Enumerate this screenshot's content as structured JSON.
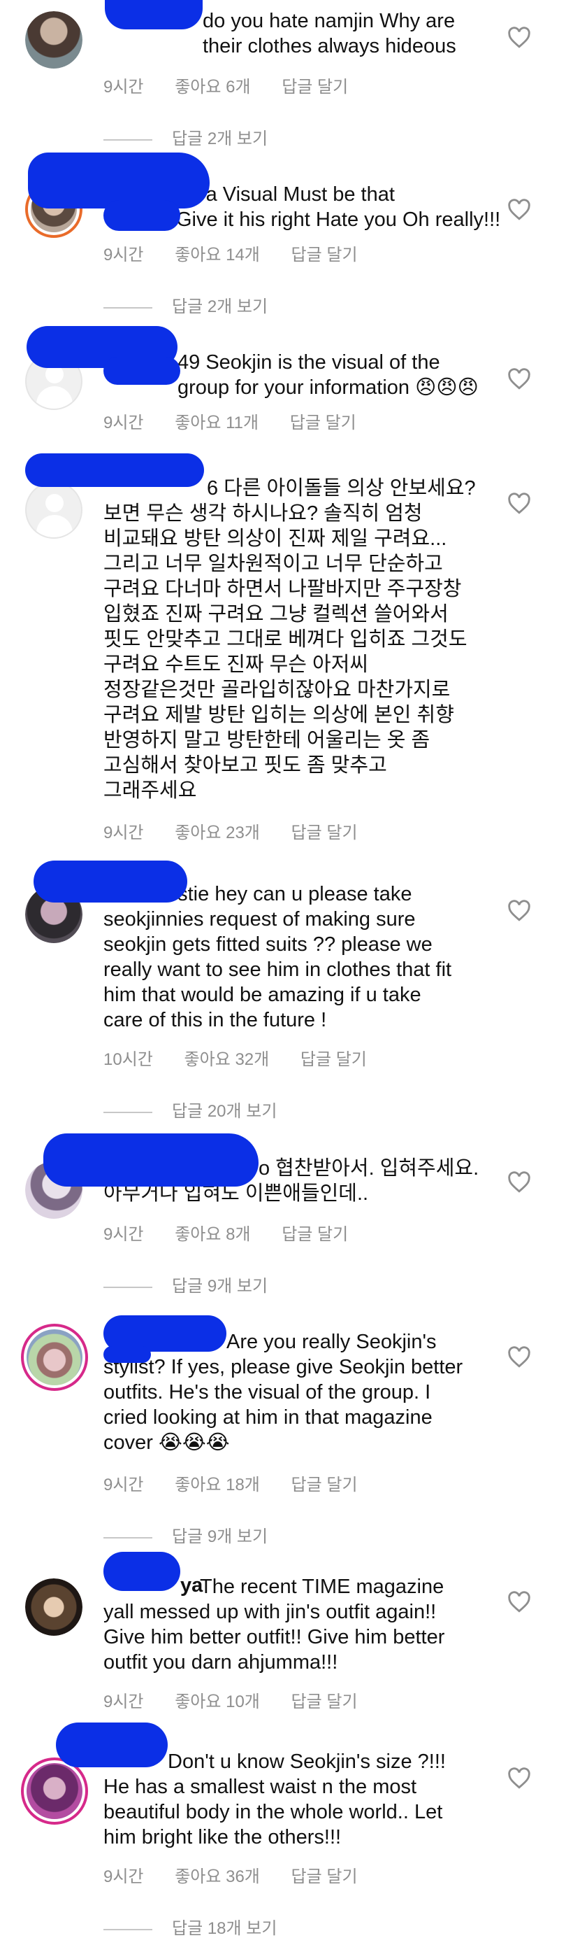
{
  "colors": {
    "scribble": "#0b2fe6",
    "meta": "#8e8e8e",
    "text": "#111111"
  },
  "comments": [
    {
      "username": "",
      "text": "do you hate namjin Why are\ntheir clothes always hideous",
      "time": "9시간",
      "likes": "좋아요 6개",
      "reply": "답글 달기",
      "view_replies": "답글 2개 보기"
    },
    {
      "username": "",
      "text": "it's a Visual Must be that\nGive it his right Hate you Oh really!!!",
      "time": "9시간",
      "likes": "좋아요 14개",
      "reply": "답글 달기",
      "view_replies": "답글 2개 보기"
    },
    {
      "username": "",
      "text": "49 Seokjin is the visual of the\ngroup for your information 😠😠😠",
      "time": "9시간",
      "likes": "좋아요 11개",
      "reply": "답글 달기",
      "view_replies": ""
    },
    {
      "username": "",
      "text": "6 다른 아이돌들 의상 안보세요?\n보면 무슨 생각 하시나요? 솔직히 엄청\n비교돼요 방탄 의상이 진짜 제일 구려요...\n그리고 너무 일차원적이고 너무 단순하고\n구려요 다너마 하면서 나팔바지만 주구장창\n입혔죠 진짜 구려요 그냥 컬렉션 쓸어와서\n핏도 안맞추고 그대로 베껴다 입히죠 그것도\n구려요 수트도 진짜 무슨 아저씨\n정장같은것만 골라입히잖아요 마찬가지로\n구려요 제발 방탄 입히는 의상에 본인 취향\n반영하지 말고 방탄한테 어울리는 옷 좀\n고심해서 찾아보고 핏도 좀 맞추고\n그래주세요",
      "time": "9시간",
      "likes": "좋아요 23개",
      "reply": "답글 달기",
      "view_replies": ""
    },
    {
      "username": "",
      "text": "estie hey can u please take\nseokjinnies request of making sure\nseokjin gets fitted suits ?? please we\nreally want to see him in clothes that fit\nhim that would be amazing if u take\ncare of this in the future !",
      "time": "10시간",
      "likes": "좋아요 32개",
      "reply": "답글 달기",
      "view_replies": "답글 20개 보기"
    },
    {
      "username": "",
      "text": "o 협찬받아서. 입혀주세요.\n아무거나 입혀도 이쁜애들인데..",
      "time": "9시간",
      "likes": "좋아요 8개",
      "reply": "답글 달기",
      "view_replies": "답글 9개 보기"
    },
    {
      "username": "",
      "text": "Are you really Seokjin's\nstylist? If yes, please give Seokjin better\noutfits. He's the visual of the group. I\ncried looking at him in that magazine\ncover 😭😭😭",
      "time": "9시간",
      "likes": "좋아요 18개",
      "reply": "답글 달기",
      "view_replies": "답글 9개 보기"
    },
    {
      "username": "ya",
      "text": "The recent TIME magazine\nyall messed up with jin's outfit again!!\nGive him better outfit!! Give him better\noutfit you darn ahjumma!!!",
      "time": "9시간",
      "likes": "좋아요 10개",
      "reply": "답글 달기",
      "view_replies": ""
    },
    {
      "username": "",
      "text": "Don't u know Seokjin's size ?!!!\nHe has a smallest waist n the most\nbeautiful body in the whole world.. Let\nhim bright like the others!!!",
      "time": "9시간",
      "likes": "좋아요 36개",
      "reply": "답글 달기",
      "view_replies": "답글 18개 보기"
    }
  ]
}
